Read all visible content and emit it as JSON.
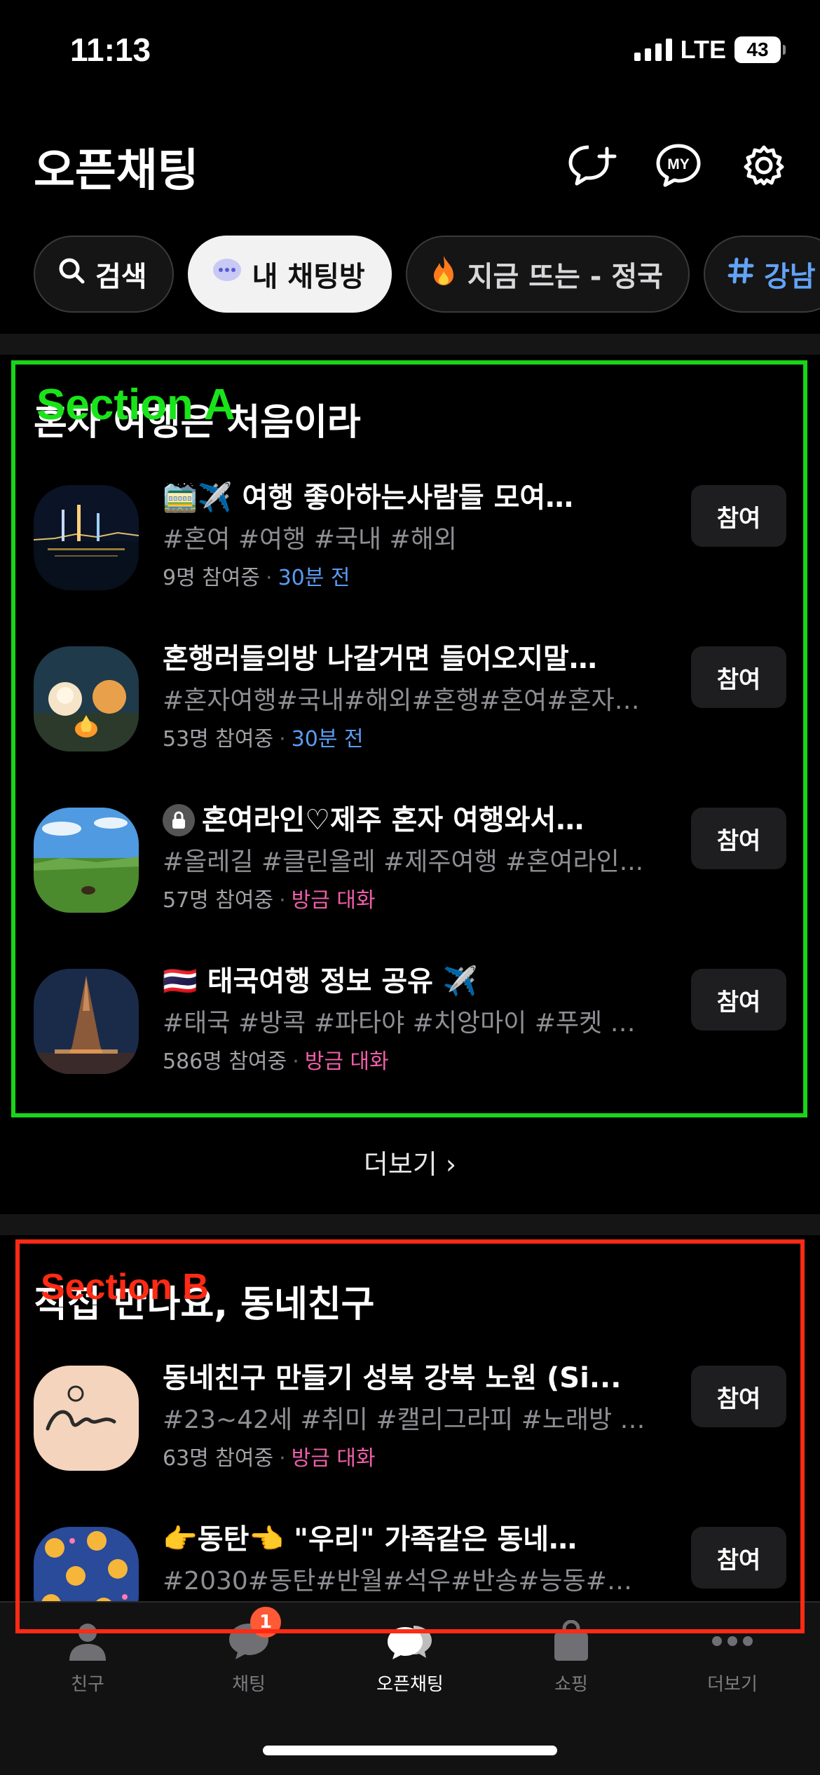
{
  "status": {
    "time": "11:13",
    "network": "LTE",
    "battery": "43"
  },
  "header": {
    "title": "오픈채팅"
  },
  "chips": [
    {
      "label": "검색",
      "icon": "search-icon"
    },
    {
      "label": "내 채팅방",
      "icon": "speech-bubble-icon"
    },
    {
      "label": "지금 뜨는 - 정국",
      "icon": "fire-icon"
    },
    {
      "label": "강남",
      "icon": "hashtag-icon"
    }
  ],
  "annotations": {
    "section_a": "Section A",
    "section_b": "Section B"
  },
  "section_a": {
    "title": "혼자 여행은 처음이라",
    "rooms": [
      {
        "title": "🚞✈️ 여행 좋아하는사람들 모여…",
        "tags": "#혼여 #여행 #국내 #해외",
        "members": "9명 참여중",
        "time": "30분 전",
        "time_style": "blue",
        "join": "참여"
      },
      {
        "title": "혼행러들의방 나갈거면 들어오지말…",
        "tags": "#혼자여행#국내#해외#혼행#혼여#혼자#…",
        "members": "53명 참여중",
        "time": "30분 전",
        "time_style": "blue",
        "join": "참여"
      },
      {
        "title": "혼여라인♡제주 혼자 여행와서…",
        "tags": "#올레길 #클린올레  #제주여행 #혼여라인...",
        "members": "57명 참여중",
        "time": "방금 대화",
        "time_style": "pink",
        "join": "참여",
        "locked": true
      },
      {
        "title": "🇹🇭 태국여행 정보 공유 ✈️",
        "tags": "#태국 #방콕 #파타야 #치앙마이 #푸켓 #2...",
        "members": "586명 참여중",
        "time": "방금 대화",
        "time_style": "pink",
        "join": "참여"
      }
    ]
  },
  "more": {
    "label": "더보기 ›"
  },
  "section_b": {
    "title": "직접 만나요, 동네친구",
    "rooms": [
      {
        "title": "동네친구 만들기 성북 강북 노원 (Si...",
        "tags": "#23~42세 #취미 #캘리그라피 #노래방 #…",
        "members": "63명 참여중",
        "time": "방금 대화",
        "time_style": "pink",
        "join": "참여"
      },
      {
        "title": "👉동탄👈 \"우리\" 가족같은 동네…",
        "tags": "#2030#동탄#반월#석우#반송#능동#병점...",
        "members": "",
        "time": "",
        "time_style": "pink",
        "join": "참여"
      }
    ]
  },
  "tabs": [
    {
      "label": "친구",
      "icon": "person-icon"
    },
    {
      "label": "채팅",
      "icon": "chat-bubble-icon",
      "badge": "1"
    },
    {
      "label": "오픈채팅",
      "icon": "open-chat-icon",
      "active": true
    },
    {
      "label": "쇼핑",
      "icon": "shopping-bag-icon"
    },
    {
      "label": "더보기",
      "icon": "more-dots-icon"
    }
  ],
  "colors": {
    "section_a_box": "#19d419",
    "section_b_box": "#ff2a14",
    "accent_blue": "#5b9cf2",
    "accent_pink": "#ef5fa8"
  }
}
